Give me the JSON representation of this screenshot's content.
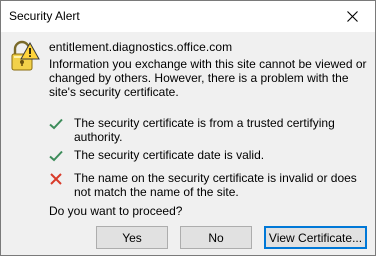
{
  "window": {
    "title": "Security Alert"
  },
  "alert": {
    "site": "entitlement.diagnostics.office.com",
    "info": "Information you exchange with this site cannot be viewed or changed by others. However, there is a problem with the site's security certificate.",
    "checks": [
      {
        "status": "ok",
        "icon": "green-checkmark-icon",
        "text": "The security certificate is from a trusted certifying authority."
      },
      {
        "status": "ok",
        "icon": "green-checkmark-icon",
        "text": "The security certificate date is valid."
      },
      {
        "status": "error",
        "icon": "red-x-icon",
        "text": "The name on the security certificate is invalid or does not match the name of the site."
      }
    ],
    "question": "Do you want to proceed?"
  },
  "buttons": {
    "yes": "Yes",
    "no": "No",
    "view_certificate": "View Certificate..."
  },
  "colors": {
    "ok": "#3c8c5a",
    "error": "#d83b2a",
    "focus": "#0078d7"
  }
}
